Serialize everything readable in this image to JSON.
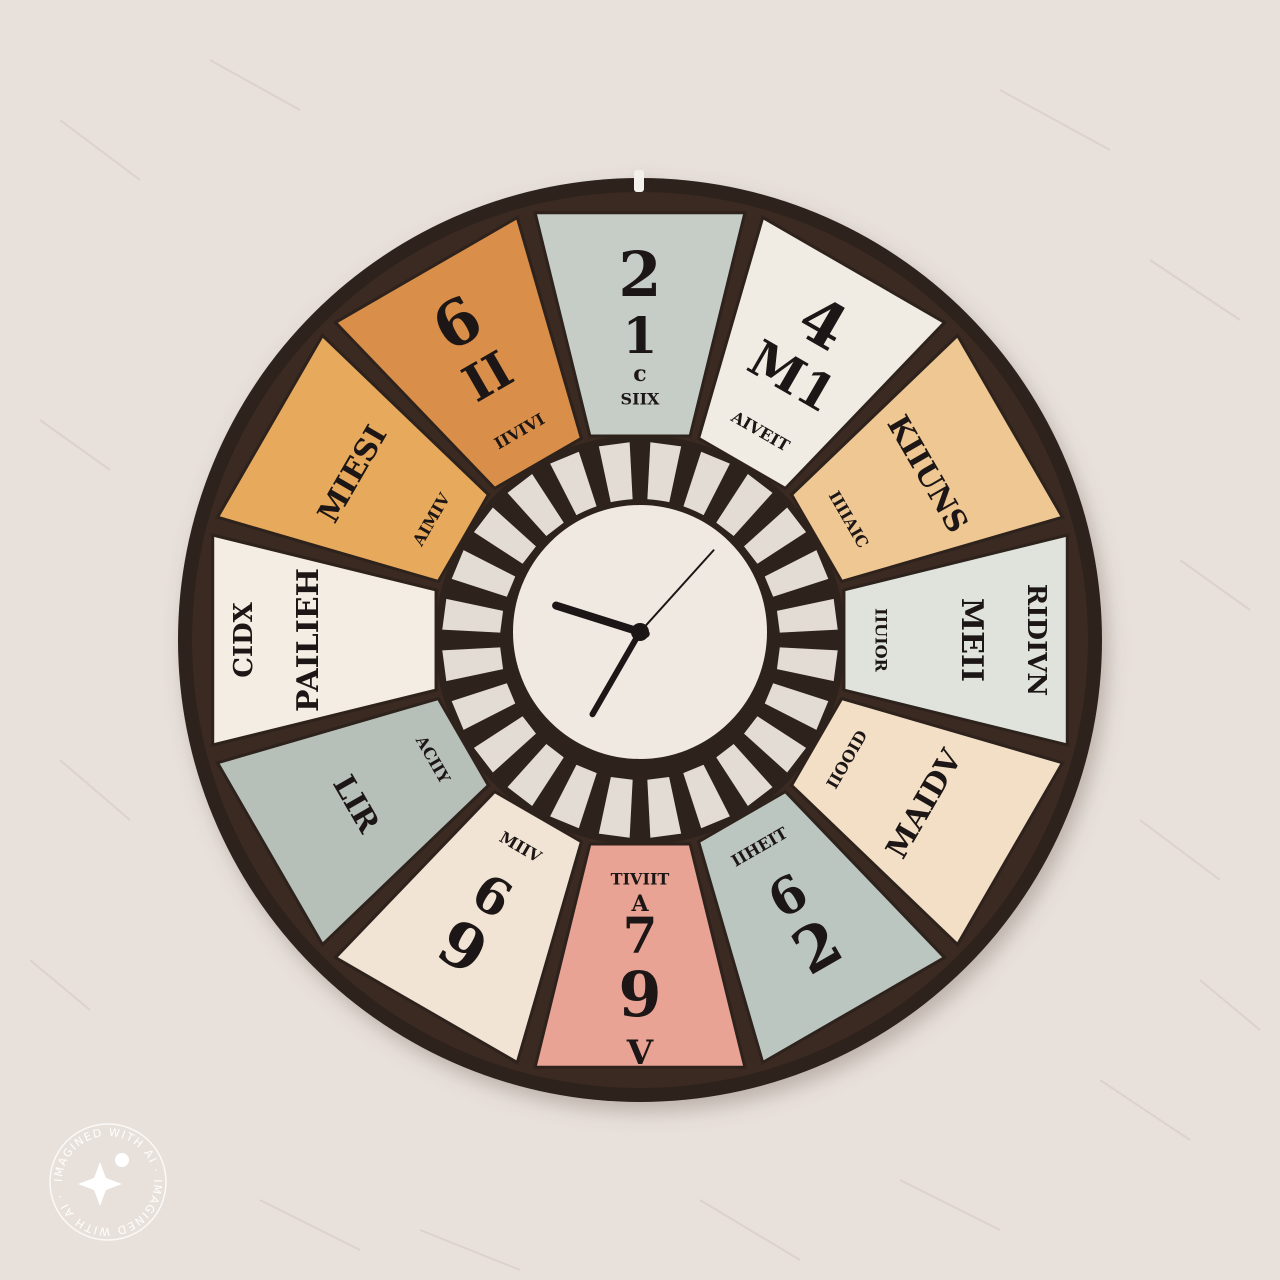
{
  "colors": {
    "wall": "#e8e1db",
    "frame": "#2e211c",
    "hub_face": "#efe9e2",
    "hands": "#1f1714",
    "badge": "#ffffff"
  },
  "clock": {
    "segments": [
      {
        "id": "seg-top",
        "fill": "#c5cdc6",
        "big": "2",
        "mid": "1",
        "small": "c",
        "tag": "SIIX"
      },
      {
        "id": "seg-top-right",
        "fill": "#f1ece3",
        "big": "4",
        "mid": "M1",
        "tag": "AIVEIT"
      },
      {
        "id": "seg-right-upper",
        "fill": "#eec793",
        "big": "KIIUNS",
        "tag": "IIIIAIC"
      },
      {
        "id": "seg-right",
        "fill": "#dfe3dc",
        "big": "MEII",
        "mid": "RIDIVN",
        "tag": "IIUIOR"
      },
      {
        "id": "seg-right-lower",
        "fill": "#f3dfc6",
        "big": "MAIDV",
        "tag": "IIOOID"
      },
      {
        "id": "seg-bottom-right",
        "fill": "#bcc6c0",
        "big": "2",
        "mid": "6",
        "tag": "IIHEIT"
      },
      {
        "id": "seg-bottom",
        "fill": "#e8a394",
        "big": "9",
        "mid": "7",
        "small": "A",
        "tag": "TIVIIT",
        "extra": "V"
      },
      {
        "id": "seg-bottom-left",
        "fill": "#f1e4d4",
        "big": "9",
        "mid": "6",
        "tag": "MIIV"
      },
      {
        "id": "seg-left-lower",
        "fill": "#b6bfb8",
        "big": "LIR",
        "tag": "ACIIY"
      },
      {
        "id": "seg-left",
        "fill": "#f4ede3",
        "big": "PAILIEH",
        "mid": "CIDX"
      },
      {
        "id": "seg-left-upper",
        "fill": "#e7aa5b",
        "big": "MIESI",
        "tag": "AIMIV"
      },
      {
        "id": "seg-top-left",
        "fill": "#d98f48",
        "big": "6",
        "mid": "II",
        "tag": "IIVIVI"
      }
    ],
    "time": {
      "hour": 9,
      "minute": 35,
      "second": 7
    }
  },
  "badge": {
    "ring_text": "IMAGINED WITH AI · IMAGINED WITH AI ·",
    "icon": "sparkle-icon"
  }
}
